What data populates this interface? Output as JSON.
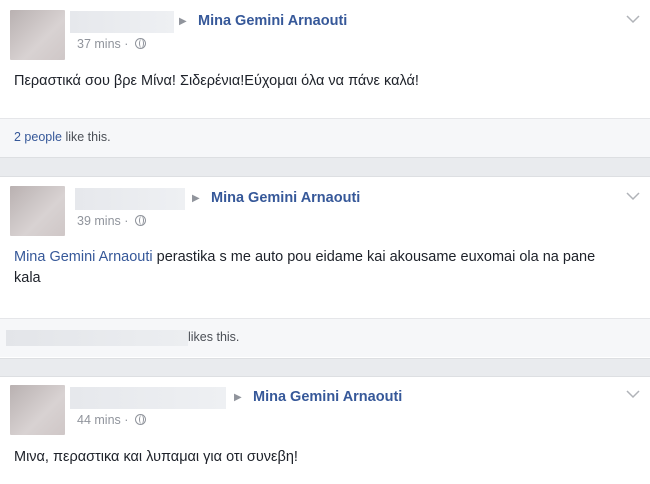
{
  "posts": [
    {
      "author": "Mina Gemini Arnaouti",
      "time": "37 mins · ",
      "text": "Περαστικά σου βρε Μίνα! Σιδερένια!Εύχομαι όλα να πάνε καλά!",
      "likes_count_link": "2 people",
      "likes_suffix": " like this."
    },
    {
      "author": "Mina Gemini Arnaouti",
      "time": "39 mins · ",
      "text_mention": "Mina Gemini Arnaouti",
      "text": " perastika s me auto pou eidame kai akousame euxomai ola na pane kala",
      "likes_suffix": "likes this."
    },
    {
      "author": "Mina Gemini Arnaouti",
      "time": "44 mins · ",
      "text": "Μινα, περαστικα και λυπαμαι για οτι συνεβη!"
    }
  ],
  "colors": {
    "link": "#365899",
    "meta": "#90949c",
    "background": "#e9ebee"
  },
  "icons": {
    "privacy": "globe-icon",
    "menu": "chevron-down-icon",
    "share_arrow": "triangle-right-icon"
  }
}
